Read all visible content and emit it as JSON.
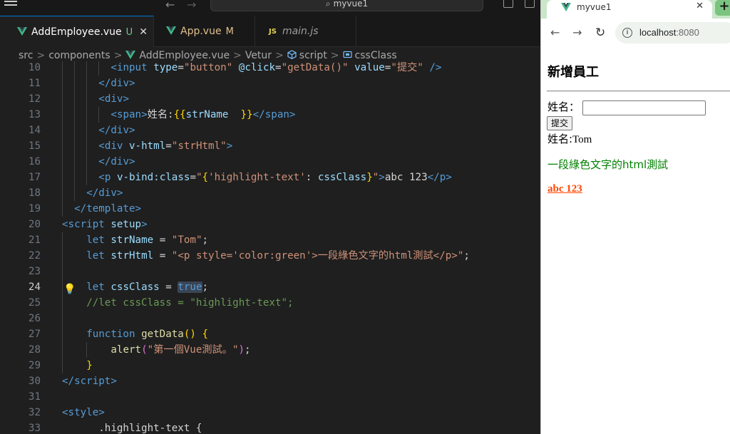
{
  "titlebar": {
    "command_center": "myvue1",
    "back_arrow": "←",
    "forward_arrow": "→"
  },
  "tabs": [
    {
      "label": "AddEmployee.vue",
      "status": "U",
      "close": "✕",
      "icon": "vue-icon"
    },
    {
      "label": "App.vue",
      "status": "M",
      "icon": "vue-icon"
    },
    {
      "label": "main.js",
      "icon": "js-icon",
      "icon_text": "JS"
    }
  ],
  "breadcrumb": {
    "items": [
      "src",
      "components",
      "AddEmployee.vue",
      "Vetur",
      "script",
      "cssClass"
    ],
    "separator": ">"
  },
  "editor": {
    "current_line": 24,
    "lines": [
      {
        "n": 10,
        "indent": 8,
        "tokens": [
          [
            "t-tag",
            "<"
          ],
          [
            "t-tag",
            "input "
          ],
          [
            "t-attr",
            "type"
          ],
          [
            "t-txt",
            "="
          ],
          [
            "t-str",
            "\"button\" "
          ],
          [
            "t-attr",
            "@click"
          ],
          [
            "t-txt",
            "="
          ],
          [
            "t-str",
            "\"getData()\" "
          ],
          [
            "t-attr",
            "value"
          ],
          [
            "t-txt",
            "="
          ],
          [
            "t-str",
            "\"提交\" "
          ],
          [
            "t-tag",
            "/>"
          ]
        ]
      },
      {
        "n": 11,
        "indent": 6,
        "tokens": [
          [
            "t-tag",
            "</"
          ],
          [
            "t-tag",
            "div"
          ],
          [
            "t-tag",
            ">"
          ]
        ]
      },
      {
        "n": 12,
        "indent": 6,
        "tokens": [
          [
            "t-tag",
            "<"
          ],
          [
            "t-tag",
            "div"
          ],
          [
            "t-tag",
            ">"
          ]
        ]
      },
      {
        "n": 13,
        "indent": 8,
        "tokens": [
          [
            "t-tag",
            "<"
          ],
          [
            "t-tag",
            "span"
          ],
          [
            "t-tag",
            ">"
          ],
          [
            "t-txt",
            "姓名:"
          ],
          [
            "t-br",
            "{{"
          ],
          [
            "t-var",
            "strName  "
          ],
          [
            "t-br",
            "}}"
          ],
          [
            "t-tag",
            "</"
          ],
          [
            "t-tag",
            "span"
          ],
          [
            "t-tag",
            ">"
          ]
        ]
      },
      {
        "n": 14,
        "indent": 6,
        "tokens": [
          [
            "t-tag",
            "</"
          ],
          [
            "t-tag",
            "div"
          ],
          [
            "t-tag",
            ">"
          ]
        ]
      },
      {
        "n": 15,
        "indent": 6,
        "tokens": [
          [
            "t-tag",
            "<"
          ],
          [
            "t-tag",
            "div "
          ],
          [
            "t-attr",
            "v-html"
          ],
          [
            "t-txt",
            "="
          ],
          [
            "t-str",
            "\"strHtml\""
          ],
          [
            "t-tag",
            ">"
          ]
        ]
      },
      {
        "n": 16,
        "indent": 6,
        "tokens": [
          [
            "t-tag",
            "</"
          ],
          [
            "t-tag",
            "div"
          ],
          [
            "t-tag",
            ">"
          ]
        ]
      },
      {
        "n": 17,
        "indent": 6,
        "tokens": [
          [
            "t-tag",
            "<"
          ],
          [
            "t-tag",
            "p "
          ],
          [
            "t-attr",
            "v-bind:class"
          ],
          [
            "t-txt",
            "="
          ],
          [
            "t-str",
            "\""
          ],
          [
            "t-br",
            "{"
          ],
          [
            "t-str",
            "'highlight-text'"
          ],
          [
            "t-txt",
            ": "
          ],
          [
            "t-var",
            "cssClass"
          ],
          [
            "t-br",
            "}"
          ],
          [
            "t-str",
            "\""
          ],
          [
            "t-tag",
            ">"
          ],
          [
            "t-txt",
            "abc 123"
          ],
          [
            "t-tag",
            "</"
          ],
          [
            "t-tag",
            "p"
          ],
          [
            "t-tag",
            ">"
          ]
        ]
      },
      {
        "n": 18,
        "indent": 4,
        "tokens": [
          [
            "t-tag",
            "</"
          ],
          [
            "t-tag",
            "div"
          ],
          [
            "t-tag",
            ">"
          ]
        ]
      },
      {
        "n": 19,
        "indent": 2,
        "tokens": [
          [
            "t-tag",
            "</"
          ],
          [
            "t-tag",
            "template"
          ],
          [
            "t-tag",
            ">"
          ]
        ]
      },
      {
        "n": 20,
        "indent": 0,
        "tokens": [
          [
            "t-tag",
            "<"
          ],
          [
            "t-tag",
            "script "
          ],
          [
            "t-attr",
            "setup"
          ],
          [
            "t-tag",
            ">"
          ]
        ]
      },
      {
        "n": 21,
        "indent": 4,
        "tokens": [
          [
            "t-kw",
            "let "
          ],
          [
            "t-var",
            "strName "
          ],
          [
            "t-txt",
            "= "
          ],
          [
            "t-str",
            "\"Tom\""
          ],
          [
            "t-txt",
            ";"
          ]
        ]
      },
      {
        "n": 22,
        "indent": 4,
        "tokens": [
          [
            "t-kw",
            "let "
          ],
          [
            "t-var",
            "strHtml "
          ],
          [
            "t-txt",
            "= "
          ],
          [
            "t-str",
            "\"<p style='color:green'>一段綠色文字的html測試</p>\""
          ],
          [
            "t-txt",
            ";"
          ]
        ]
      },
      {
        "n": 23,
        "indent": 0,
        "tokens": []
      },
      {
        "n": 24,
        "indent": 4,
        "tokens": [
          [
            "t-kw",
            "let "
          ],
          [
            "t-var",
            "cssClass "
          ],
          [
            "t-txt",
            "= "
          ],
          [
            "t-kw t-hl",
            "true"
          ],
          [
            "t-txt",
            ";"
          ]
        ]
      },
      {
        "n": 25,
        "indent": 4,
        "tokens": [
          [
            "t-cmt",
            "//let cssClass = \"highlight-text\";"
          ]
        ]
      },
      {
        "n": 26,
        "indent": 0,
        "tokens": []
      },
      {
        "n": 27,
        "indent": 4,
        "tokens": [
          [
            "t-kw",
            "function "
          ],
          [
            "t-fn",
            "getData"
          ],
          [
            "t-br",
            "()"
          ],
          [
            "t-txt",
            " "
          ],
          [
            "t-br",
            "{"
          ]
        ]
      },
      {
        "n": 28,
        "indent": 8,
        "tokens": [
          [
            "t-fn",
            "alert"
          ],
          [
            "t-br2",
            "("
          ],
          [
            "t-str",
            "\"第一個Vue測試。\""
          ],
          [
            "t-br2",
            ")"
          ],
          [
            "t-txt",
            ";"
          ]
        ]
      },
      {
        "n": 29,
        "indent": 4,
        "tokens": [
          [
            "t-br",
            "}"
          ]
        ]
      },
      {
        "n": 30,
        "indent": 0,
        "tokens": [
          [
            "t-tag",
            "</"
          ],
          [
            "t-tag",
            "script"
          ],
          [
            "t-tag",
            ">"
          ]
        ]
      },
      {
        "n": 31,
        "indent": 0,
        "tokens": []
      },
      {
        "n": 32,
        "indent": 0,
        "tokens": [
          [
            "t-tag",
            "<"
          ],
          [
            "t-tag",
            "style"
          ],
          [
            "t-tag",
            ">"
          ]
        ]
      },
      {
        "n": 33,
        "indent": 4,
        "tokens": [
          [
            "t-txt",
            "  .highlight-text {"
          ]
        ]
      }
    ]
  },
  "browser": {
    "tab_title": "myvue1",
    "tab_close": "✕",
    "new_tab": "+",
    "url_host": "localhost",
    "url_port": ":8080",
    "page": {
      "title": "新增員工",
      "name_label": "姓名：",
      "name_value": "",
      "submit_label": "提交",
      "name_output_prefix": "姓名:",
      "name_output_value": "Tom",
      "green_text": "一段綠色文字的html測試",
      "highlight_text": "abc 123"
    }
  },
  "colors": {
    "accent": "#0078d4",
    "green_text": "#008000",
    "highlight_text": "#ff4500",
    "browser_chrome": "#c9e6c9"
  }
}
